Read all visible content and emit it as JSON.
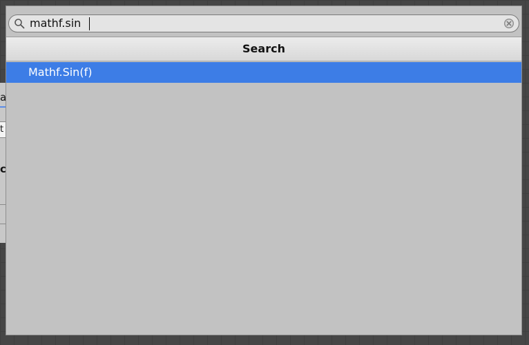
{
  "background": {
    "fragment_a": "a",
    "fragment_t": "t",
    "fragment_c": "c"
  },
  "search": {
    "value": "mathf.sin",
    "placeholder": "",
    "search_icon": "search-icon",
    "clear_icon": "clear-icon"
  },
  "header": {
    "title": "Search"
  },
  "results": [
    {
      "label": "Mathf.Sin(f)",
      "selected": true
    }
  ],
  "colors": {
    "selection": "#3d7de6",
    "popup_bg": "#c2c2c2",
    "canvas_bg": "#464646"
  }
}
